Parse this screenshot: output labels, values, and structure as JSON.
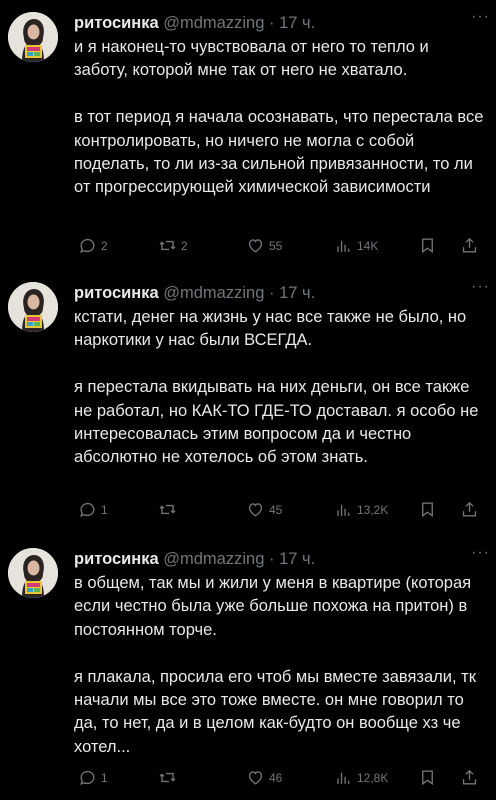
{
  "tweets": [
    {
      "name": "ритосинка",
      "handle": "@mdmazzing",
      "dot": "·",
      "time": "17 ч.",
      "paragraphs": [
        "и я наконец-то чувствовала от него то тепло и заботу, которой мне так от него не хватало.",
        "в тот период я начала осознавать, что перестала все контролировать, но ничего не могла с собой поделать, то ли из-за сильной привязанности, то ли от прогрессирующей химической зависимости"
      ],
      "replies": "2",
      "retweets": "2",
      "likes": "55",
      "views": "14K"
    },
    {
      "name": "ритосинка",
      "handle": "@mdmazzing",
      "dot": "·",
      "time": "17 ч.",
      "paragraphs": [
        "кстати, денег на жизнь у нас все также не было, но наркотики у нас были ВСЕГДА.",
        "я перестала вкидывать на них деньги, он все также не работал, но КАК-ТО ГДЕ-ТО доставал. я особо не интересовалась этим вопросом да и честно абсолютно не хотелось об этом знать."
      ],
      "replies": "1",
      "retweets": "",
      "likes": "45",
      "views": "13,2K"
    },
    {
      "name": "ритосинка",
      "handle": "@mdmazzing",
      "dot": "·",
      "time": "17 ч.",
      "paragraphs": [
        "в общем, так мы и жили у меня в квартире (которая если честно была уже больше похожа на притон) в постоянном торче.",
        "я плакала, просила его чтоб мы вместе завязали, тк начали мы все это тоже вместе. он мне говорил то да, то нет, да и в целом как-будто он вообще хз че хотел..."
      ],
      "replies": "1",
      "retweets": "",
      "likes": "46",
      "views": "12,8K"
    }
  ],
  "more_label": "···",
  "icons": {
    "reply": "reply-icon",
    "retweet": "retweet-icon",
    "like": "heart-icon",
    "views": "views-icon",
    "bookmark": "bookmark-icon",
    "share": "share-icon"
  },
  "colors": {
    "background": "#000000",
    "text": "#e7e9ea",
    "muted": "#71767b"
  }
}
